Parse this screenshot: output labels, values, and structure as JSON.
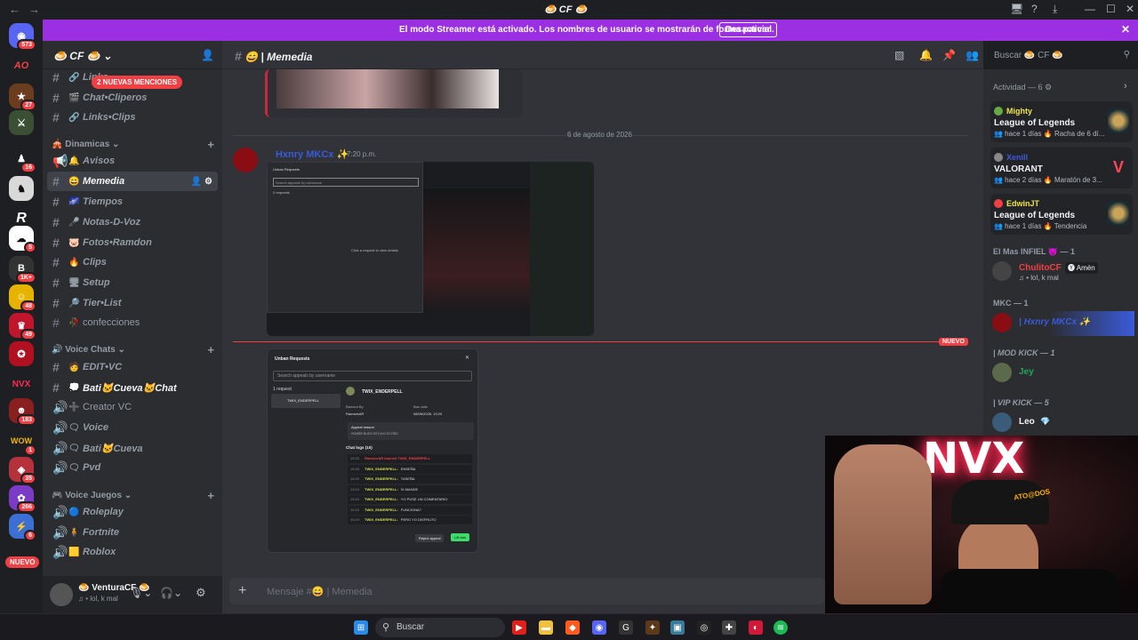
{
  "window": {
    "title": "🍮 CF 🍮",
    "back": "←",
    "forward": "→",
    "controls": [
      "🖥",
      "?",
      "⤓",
      "—",
      "☐",
      "✕"
    ]
  },
  "server_rail": {
    "badges": [
      "573",
      "27",
      "16",
      "5",
      "1K+",
      "48",
      "49",
      "183",
      "1",
      "35",
      "266",
      "6"
    ],
    "new_label": "NUEVO"
  },
  "banner": {
    "text": "El modo Streamer está activado. Los nombres de usuario se mostrarán de forma parcial.",
    "button": "Desactivar",
    "close": "✕"
  },
  "server": {
    "name": "🍮 CF 🍮",
    "chevron": "⌄"
  },
  "mentions_pill": "2 NUEVAS MENCIONES",
  "channels_top": [
    {
      "emoji": "🔗",
      "name": "Links"
    },
    {
      "emoji": "🎬",
      "name": "Chat•Cliperos"
    },
    {
      "emoji": "🔗",
      "name": "Links•Clips"
    }
  ],
  "categories": {
    "dinamicas": "Dinamicas",
    "voice_chats": "Voice Chats",
    "voice_juegos": "Voice Juegos"
  },
  "channels_dinamicas": [
    {
      "emoji": "🔔",
      "name": "Avisos"
    },
    {
      "emoji": "😄",
      "name": "Memedia"
    },
    {
      "emoji": "🌌",
      "name": "Tiempos"
    },
    {
      "emoji": "🎤",
      "name": "Notas-D-Voz"
    },
    {
      "emoji": "🐷",
      "name": "Fotos•Ramdon"
    },
    {
      "emoji": "🔥",
      "name": "Clips"
    },
    {
      "emoji": "🖥",
      "name": "Setup"
    },
    {
      "emoji": "🔎",
      "name": "Tier•List"
    },
    {
      "emoji": "🥀",
      "name": "confecciones"
    }
  ],
  "channels_voice_chats": [
    {
      "emoji": "🧑",
      "name": "EDIT•VC"
    },
    {
      "emoji": "💭",
      "name": "Bati🐱Cueva🐱Chat"
    },
    {
      "emoji": "➕",
      "name": "Creator VC"
    },
    {
      "emoji": "🗨",
      "name": "Voice"
    },
    {
      "emoji": "🗨",
      "name": "Bati🐱Cueva"
    },
    {
      "emoji": "🗨",
      "name": "Pvd"
    }
  ],
  "channels_voice_juegos": [
    {
      "emoji": "🔵",
      "name": "Roleplay"
    },
    {
      "emoji": "🧍",
      "name": "Fortnite"
    },
    {
      "emoji": "🟨",
      "name": "Roblox"
    }
  ],
  "user": {
    "name": "VenturaCF",
    "status": "♫ • lol, k mal"
  },
  "chat": {
    "channel": "😄 | Memedia",
    "date_divider": "6 de agosto de 2026",
    "author": "Hxnry MKCx ✨",
    "time": "7:20 p.m.",
    "new_badge": "NUEVO",
    "composer_placeholder": "Mensaje #😄 | Memedia"
  },
  "screenshot1": {
    "title": "Unban Requests",
    "search": "Search appeals by username",
    "count": "0 requests",
    "empty": "Click a request to view details"
  },
  "screenshot2": {
    "title": "Unban Requests",
    "search": "Search appeals by username",
    "count": "1 request",
    "user": "TWIX_ENDERPELL",
    "date": "08/06/2026, 19:20",
    "banned_by_label": "Banned By",
    "banned_by": "RamsesAR",
    "ban_date_label": "Ban date",
    "appeal_label": "Appeal reason",
    "appeal_text": "HOMBR BUEN ESTUVO ECOÑO",
    "logs_label": "Chat logs (10)",
    "reject": "Reject appeal",
    "lift": "Lift ban",
    "logs": [
      {
        "t": "19:20",
        "u": "RamsesAR banned TWIX_ENDERPELL",
        "m": ""
      },
      {
        "t": "19:20",
        "u": "TWIX_ENDERPELL:",
        "m": "ENSEÑA"
      },
      {
        "t": "19:20",
        "u": "TWIX_ENDERPELL:",
        "m": "TASEÑA"
      },
      {
        "t": "19:19",
        "u": "TWIX_ENDERPELL:",
        "m": "SI MANDE"
      },
      {
        "t": "19:19",
        "u": "TWIX_ENDERPELL:",
        "m": "YO PUSE UN COMENTARIO"
      },
      {
        "t": "19:19",
        "u": "TWIX_ENDERPELL:",
        "m": "FUNCIONA?"
      },
      {
        "t": "19:19",
        "u": "TWIX_ENDERPELL:",
        "m": "PERO YO DISFRUTO"
      }
    ]
  },
  "search": {
    "placeholder": "Buscar 🍮 CF 🍮"
  },
  "activity": {
    "header": "Actividad — 6 ⚙",
    "cards": [
      {
        "who": "Mighty",
        "who_color": "#f0e442",
        "game": "League of Legends",
        "meta": "👥 hace 1 días  🔥 Racha de 6 dí..."
      },
      {
        "who": "Xenill",
        "who_color": "#3a5bd9",
        "game": "VALORANT",
        "meta": "👥 hace 2 días  🔥 Maratón de 3..."
      },
      {
        "who": "EdwinJT",
        "who_color": "#f0e442",
        "game": "League of Legends",
        "meta": "👥 hace 1 días  🔥 Tendencia"
      }
    ],
    "groups": [
      {
        "label": "El Mas INFIEL 😈 — 1"
      },
      {
        "label": "MKC — 1"
      },
      {
        "label": "| MOD KICK — 1"
      },
      {
        "label": "| VIP KICK — 5"
      }
    ],
    "members": [
      {
        "name": "ChulitoCF",
        "tag": "🅨 Amén",
        "status": "♫ • lol, k mal",
        "color": "#f23f43"
      },
      {
        "name": "| Hxnry MKCx ✨",
        "tag": "",
        "status": "",
        "color": "#3a5bd9"
      },
      {
        "name": "Jey",
        "tag": "",
        "status": "",
        "color": "#23a55a"
      },
      {
        "name": "Leo",
        "tag": "💎",
        "status": "",
        "color": "#f2f3f5"
      }
    ]
  },
  "webcam": {
    "sign": "NVX",
    "cap": "ATO@DOS"
  },
  "taskbar": {
    "search": "Buscar"
  },
  "colors": {
    "accent": "#9b30e3",
    "danger": "#f23f43",
    "nvx": "#ff2a55"
  }
}
